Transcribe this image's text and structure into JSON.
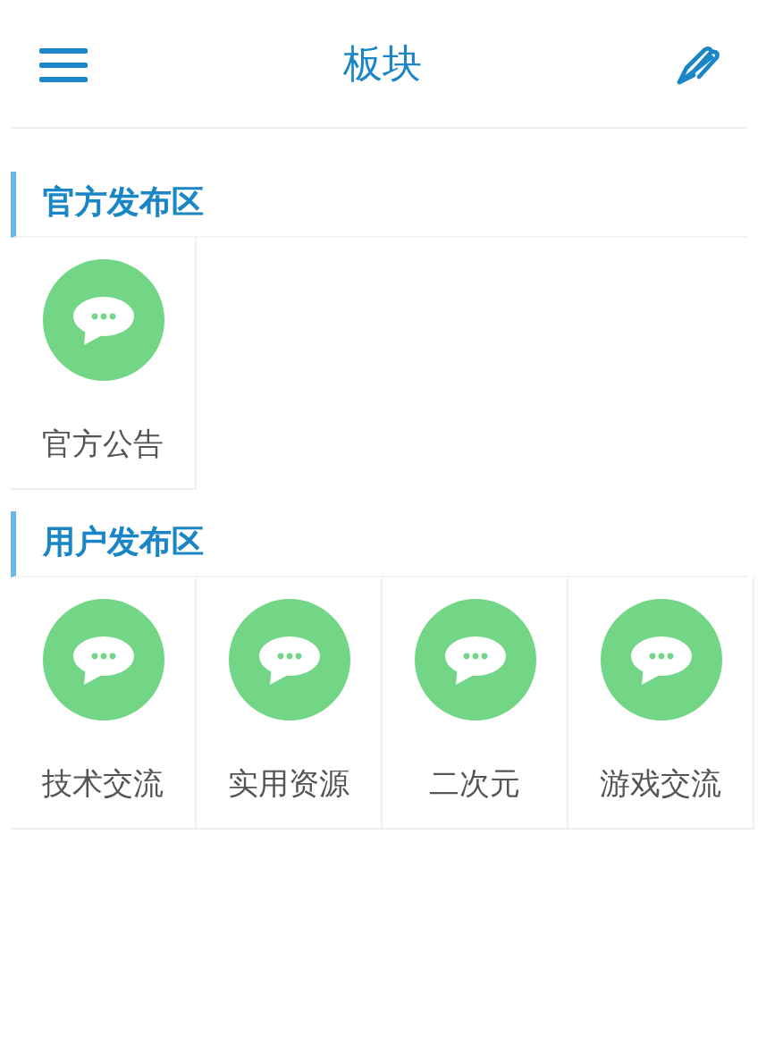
{
  "header": {
    "title": "板块"
  },
  "sections": [
    {
      "title": "官方发布区",
      "boards": [
        {
          "name": "官方公告"
        }
      ]
    },
    {
      "title": "用户发布区",
      "boards": [
        {
          "name": "技术交流"
        },
        {
          "name": "实用资源"
        },
        {
          "name": "二次元"
        },
        {
          "name": "游戏交流"
        }
      ]
    }
  ]
}
